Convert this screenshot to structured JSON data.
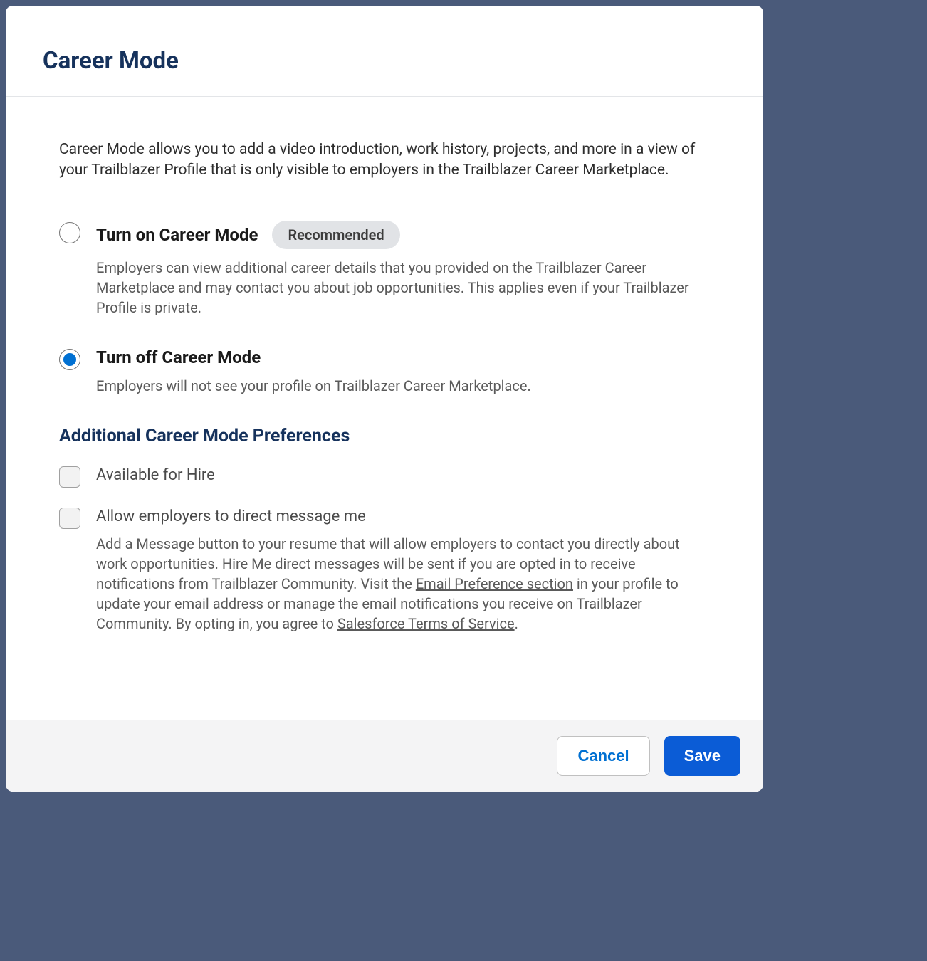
{
  "header": {
    "title": "Career Mode"
  },
  "intro": "Career Mode allows you to add a video introduction, work history, projects, and more in a view of your Trailblazer Profile that is only visible to employers in the Trailblazer Career Marketplace.",
  "options": [
    {
      "label": "Turn on Career Mode",
      "badge": "Recommended",
      "description": "Employers can view additional career details that you provided on the Trailblazer Career Marketplace and may contact you about job opportunities. This applies even if your Trailblazer Profile is private.",
      "selected": false
    },
    {
      "label": "Turn off Career Mode",
      "badge": null,
      "description": "Employers will not see your profile on Trailblazer Career Marketplace.",
      "selected": true
    }
  ],
  "preferences": {
    "heading": "Additional Career Mode Preferences",
    "items": [
      {
        "label": "Available for Hire",
        "checked": false
      },
      {
        "label": "Allow employers to direct message me",
        "checked": false,
        "desc_parts": {
          "p1": "Add a Message button to your resume that will allow employers to contact you directly about work opportunities. Hire Me direct messages will be sent if you are opted in to receive notifications from Trailblazer Community. Visit the ",
          "link1": "Email Preference section",
          "p2": " in your profile to update your email address or manage the email notifications you receive on Trailblazer Community. By opting in, you agree to ",
          "link2": "Salesforce Terms of Service",
          "p3": "."
        }
      }
    ]
  },
  "footer": {
    "cancel": "Cancel",
    "save": "Save"
  }
}
